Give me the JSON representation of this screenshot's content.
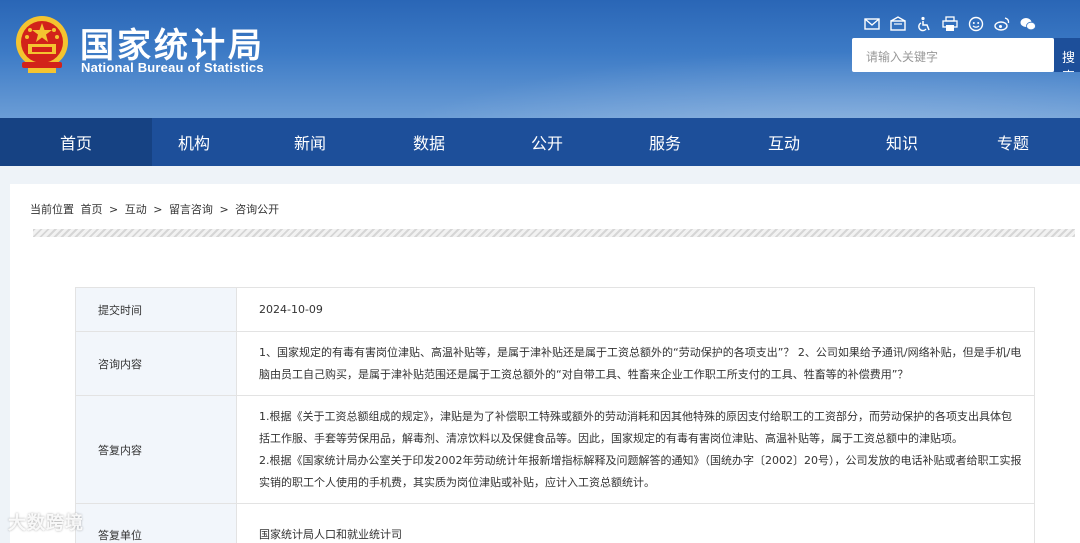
{
  "header": {
    "title_cn": "国家统计局",
    "title_en": "National Bureau of Statistics",
    "tools": [
      "mail-icon",
      "mail-read-icon",
      "accessibility-icon",
      "print-icon",
      "elder-mode-icon",
      "weibo-icon",
      "wechat-icon"
    ],
    "search_placeholder": "请输入关键字",
    "search_button": "搜索"
  },
  "nav": {
    "items": [
      "首页",
      "机构",
      "新闻",
      "数据",
      "公开",
      "服务",
      "互动",
      "知识",
      "专题"
    ]
  },
  "breadcrumb": {
    "label": "当前位置",
    "items": [
      "首页",
      "互动",
      "留言咨询",
      "咨询公开"
    ],
    "separator": ">"
  },
  "qa": {
    "submit_time_label": "提交时间",
    "submit_time": "2024-10-09",
    "question_label": "咨询内容",
    "question": "1、国家规定的有毒有害岗位津贴、高温补贴等，是属于津补贴还是属于工资总额外的“劳动保护的各项支出”？ 2、公司如果给予通讯/网络补贴，但是手机/电脑由员工自己购买，是属于津补贴范围还是属于工资总额外的“对自带工具、牲畜来企业工作职工所支付的工具、牲畜等的补偿费用”？",
    "answer_label": "答复内容",
    "answer_p1": "1.根据《关于工资总额组成的规定》，津贴是为了补偿职工特殊或额外的劳动消耗和因其他特殊的原因支付给职工的工资部分，而劳动保护的各项支出具体包括工作服、手套等劳保用品，解毒剂、清凉饮料以及保健食品等。因此，国家规定的有毒有害岗位津贴、高温补贴等，属于工资总额中的津贴项。",
    "answer_p2": "2.根据《国家统计局办公室关于印发2002年劳动统计年报新增指标解释及问题解答的通知》（国统办字〔2002〕20号），公司发放的电话补贴或者给职工实报实销的职工个人使用的手机费，其实质为岗位津贴或补贴，应计入工资总额统计。",
    "unit_label": "答复单位",
    "unit": "国家统计局人口和就业统计司"
  },
  "watermark": "大数跨境",
  "colors": {
    "header_blue": "#2a66b6",
    "nav_blue": "#1d4f9a",
    "nav_active": "#164283",
    "label_bg": "#f2f6fb"
  }
}
